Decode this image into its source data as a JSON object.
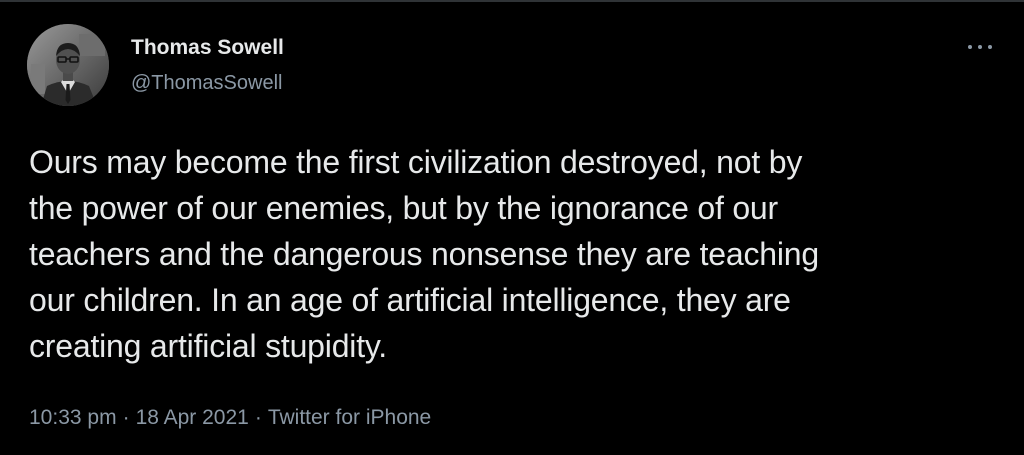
{
  "tweet": {
    "author": {
      "name": "Thomas Sowell",
      "handle": "@ThomasSowell",
      "avatar_icon": "profile-photo-avatar"
    },
    "more_icon": "more-horizontal-icon",
    "text_lines": [
      "Ours may become the first civilization destroyed, not by",
      "the power of our enemies, but by the ignorance of our",
      "teachers and the dangerous nonsense they are teaching",
      "our children. In an age of artificial intelligence, they are",
      "creating artificial stupidity."
    ],
    "meta": {
      "time": "10:33 pm",
      "separator": "·",
      "date": "18 Apr 2021",
      "source": "Twitter for iPhone"
    }
  },
  "colors": {
    "background": "#000000",
    "primary_text": "#e7e9ea",
    "secondary_text": "#8b98a5",
    "divider": "#2f3336"
  }
}
